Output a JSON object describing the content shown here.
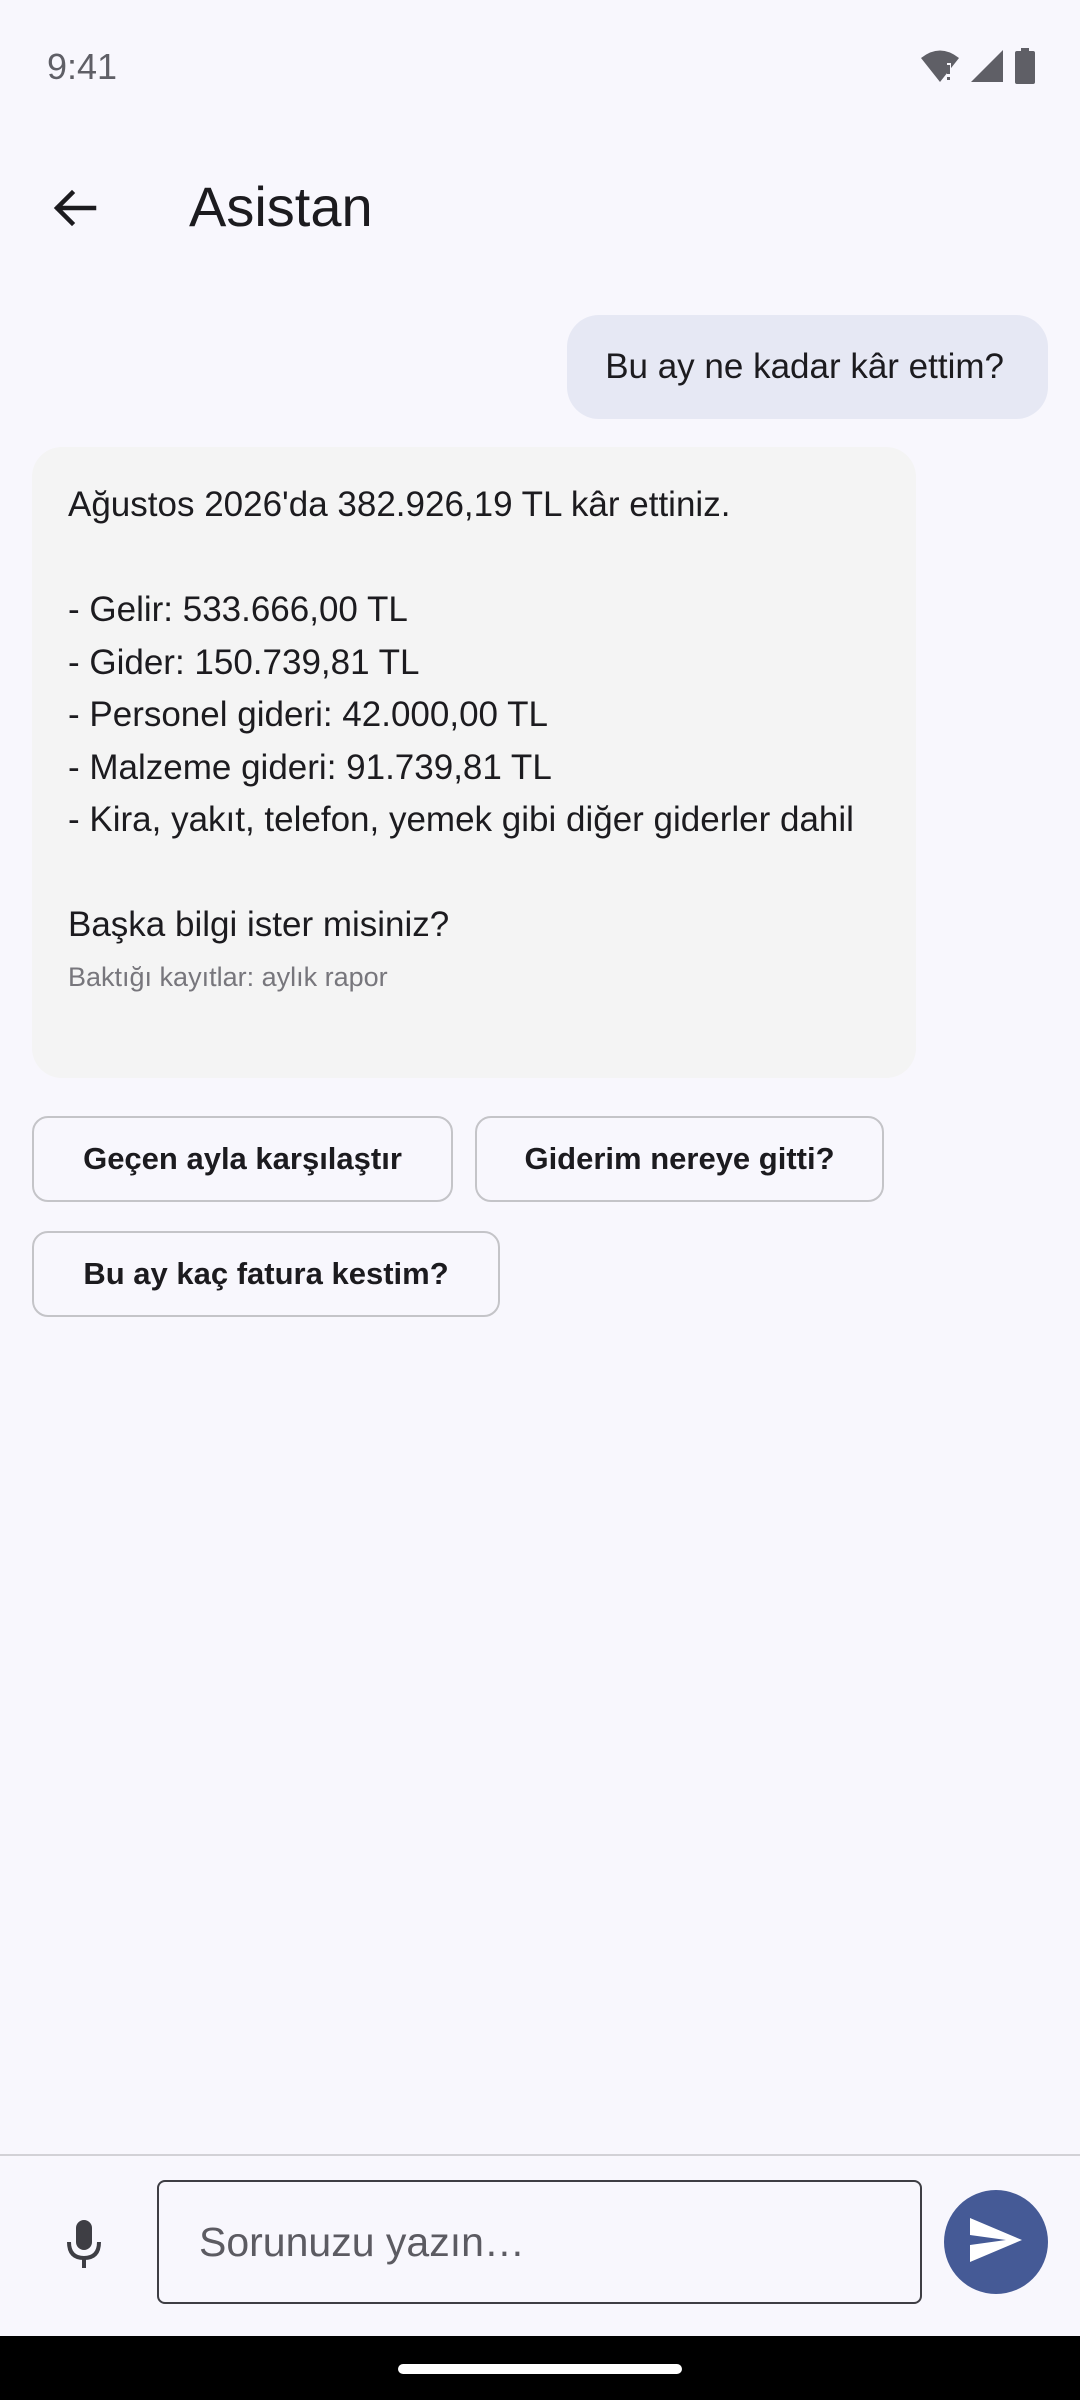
{
  "status_bar": {
    "time": "9:41",
    "icons": [
      "wifi-icon",
      "signal-icon",
      "battery-icon"
    ]
  },
  "app_bar": {
    "title": "Asistan",
    "back_icon": "arrow-back-icon"
  },
  "chat": {
    "user_message": "Bu ay ne kadar kâr ettim?",
    "bot_message": {
      "text": "Ağustos 2026'da 382.926,19 TL kâr ettiniz.\n\n- Gelir: 533.666,00 TL\n- Gider: 150.739,81 TL\n- Personel gideri: 42.000,00 TL\n- Malzeme gideri: 91.739,81 TL\n- Kira, yakıt, telefon, yemek gibi diğer giderler dahil\n\nBaşka bilgi ister misiniz?",
      "source": "Baktığı kayıtlar: aylık rapor"
    }
  },
  "suggestions": [
    {
      "label": "Geçen ayla karşılaştır"
    },
    {
      "label": "Giderim nereye gitti?"
    },
    {
      "label": "Bu ay kaç fatura kestim?"
    }
  ],
  "composer": {
    "placeholder": "Sorunuzu yazın…",
    "value": "",
    "mic_icon": "mic-icon",
    "send_icon": "send-icon"
  },
  "colors": {
    "background": "#f8f7fd",
    "user_bubble": "#e6e8f4",
    "bot_bubble": "#f4f4f4",
    "send_button": "#455a96"
  }
}
